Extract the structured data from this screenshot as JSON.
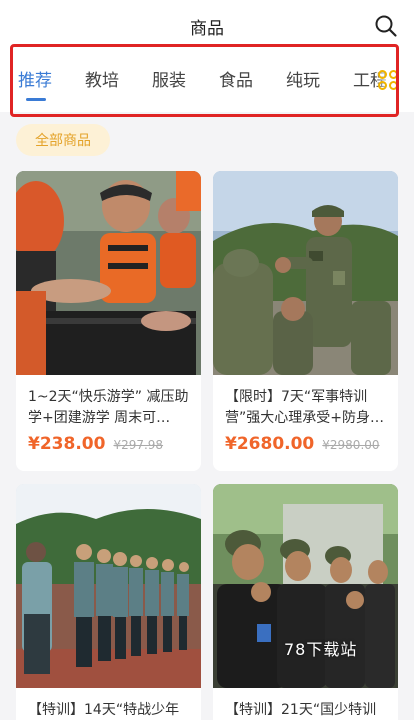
{
  "header": {
    "title": "商品",
    "search_icon": "search-icon"
  },
  "tabs": [
    {
      "label": "推荐",
      "active": true
    },
    {
      "label": "教培",
      "active": false
    },
    {
      "label": "服装",
      "active": false
    },
    {
      "label": "食品",
      "active": false
    },
    {
      "label": "纯玩",
      "active": false
    },
    {
      "label": "工程",
      "active": false
    }
  ],
  "tab_grid_icon": "grid-circles-icon",
  "filter": {
    "all_label": "全部商品"
  },
  "products": [
    {
      "name": "1~2天“快乐游学” 减压助学+团建游学 周末可…",
      "price": "¥238.00",
      "original_price": "¥297.98",
      "image": "kids-in-life-jackets-photo"
    },
    {
      "name": "【限时】7天“军事特训营”强大心理承受+防身…",
      "price": "¥2680.00",
      "original_price": "¥2980.00",
      "image": "camouflage-soldier-training-photo"
    },
    {
      "name": "【特训】14天“特战少年",
      "price": "",
      "original_price": "",
      "image": "students-saluting-photo"
    },
    {
      "name": "【特训】21天“国少特训",
      "price": "",
      "original_price": "",
      "image": "kids-military-drill-photo"
    }
  ],
  "colors": {
    "accent": "#3a7bd5",
    "price": "#f0652a",
    "chip_bg": "#fdf1d6",
    "chip_text": "#e4a32a",
    "highlight": "#e02424"
  },
  "watermark": "78下载站"
}
